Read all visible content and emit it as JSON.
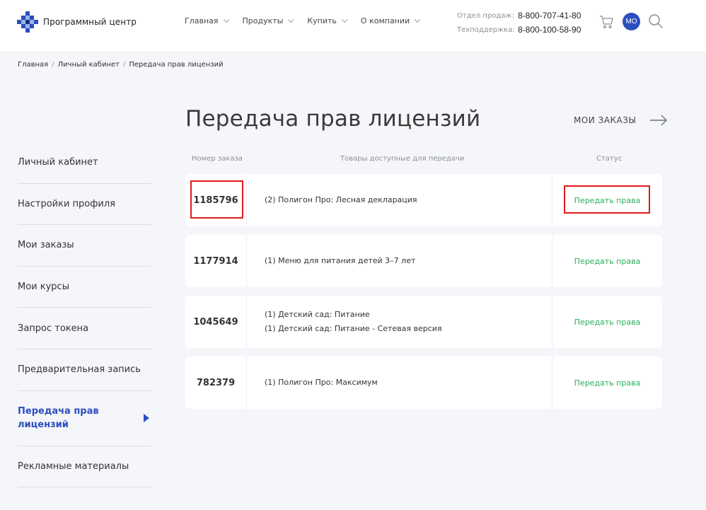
{
  "header": {
    "logo_text": "Программный центр",
    "nav": [
      {
        "label": "Главная"
      },
      {
        "label": "Продукты"
      },
      {
        "label": "Купить"
      },
      {
        "label": "О компании"
      }
    ],
    "contacts": [
      {
        "label": "Отдел продаж:",
        "phone": "8-800-707-41-80"
      },
      {
        "label": "Техподдержка:",
        "phone": "8-800-100-58-90"
      }
    ],
    "avatar_initials": "МО",
    "icons": {
      "cart": "cart-icon",
      "search": "search-icon",
      "logo": "logo-icon"
    }
  },
  "breadcrumb": [
    "Главная",
    "Личный кабинет",
    "Передача прав лицензий"
  ],
  "sidebar": {
    "items": [
      {
        "label": "Личный кабинет"
      },
      {
        "label": "Настройки профиля"
      },
      {
        "label": "Мои заказы"
      },
      {
        "label": "Мои курсы"
      },
      {
        "label": "Запрос токена"
      },
      {
        "label": "Предварительная запись"
      },
      {
        "label": "Передача прав лицензий",
        "active": true
      },
      {
        "label": "Рекламные материалы"
      }
    ]
  },
  "main": {
    "title": "Передача прав лицензий",
    "my_orders_link": "МОИ ЗАКАЗЫ",
    "columns": {
      "order_number": "Номер заказа",
      "goods": "Товары доступные для передачи",
      "status": "Статус"
    },
    "orders": [
      {
        "number": "1185796",
        "goods": [
          "(2) Полигон Про: Лесная декларация"
        ],
        "action": "Передать права"
      },
      {
        "number": "1177914",
        "goods": [
          "(1) Меню для питания детей 3–7 лет"
        ],
        "action": "Передать права"
      },
      {
        "number": "1045649",
        "goods": [
          "(1) Детский сад: Питание",
          "(1) Детский сад: Питание - Сетевая версия"
        ],
        "action": "Передать права"
      },
      {
        "number": "782379",
        "goods": [
          "(1) Полигон Про: Максимум"
        ],
        "action": "Передать права"
      }
    ]
  },
  "colors": {
    "accent": "#2a4fbf",
    "action_green": "#2bae5a",
    "highlight_red": "#e01a1a",
    "background": "#f5f6f9"
  }
}
